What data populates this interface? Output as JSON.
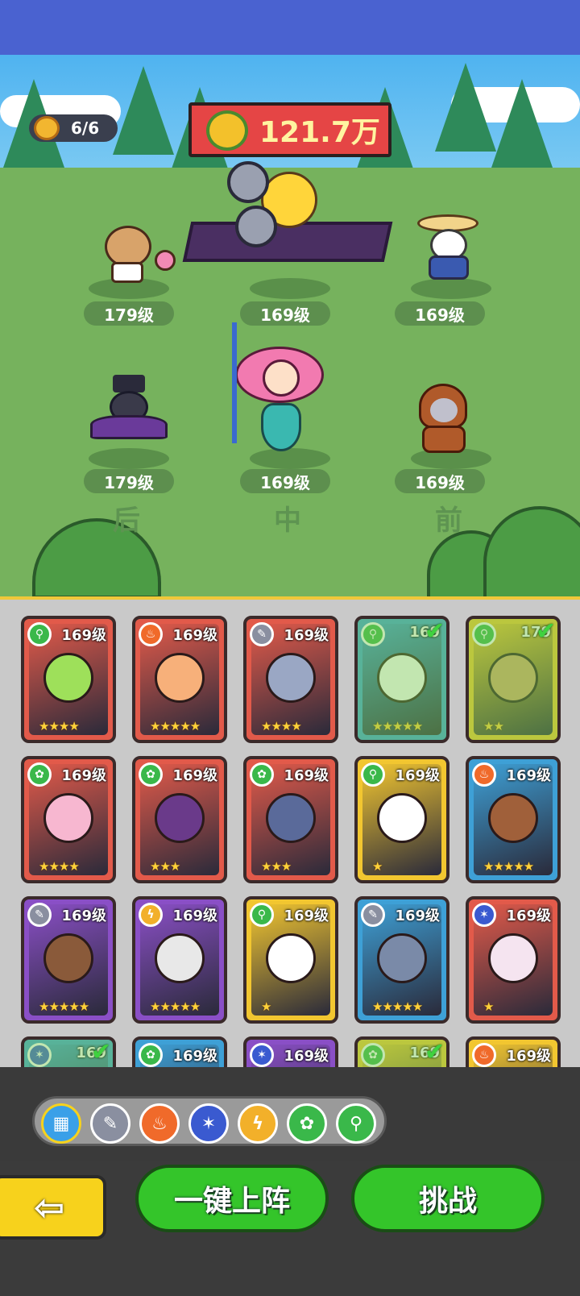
{
  "header": {
    "team_count": "6/6",
    "power": "121.7万"
  },
  "formation": {
    "top": [
      {
        "name": "deer",
        "level": "179级"
      },
      {
        "name": "chicken-warrior",
        "level": "169级"
      },
      {
        "name": "duck-wizard",
        "level": "169级"
      }
    ],
    "bottom": [
      {
        "name": "plague-crow",
        "level": "179级"
      },
      {
        "name": "mermaid",
        "level": "169级"
      },
      {
        "name": "mouse-hood",
        "level": "169级"
      }
    ],
    "row_labels": {
      "back": "后",
      "middle": "中",
      "front": "前"
    }
  },
  "cards": [
    {
      "level": "169级",
      "element": "wind",
      "stars": "★★★★",
      "color": "#e25a4a",
      "face": "#9ee05a",
      "selected": false
    },
    {
      "level": "169级",
      "element": "fire",
      "stars": "★★★★★",
      "color": "#e25a4a",
      "face": "#f7b07a",
      "selected": false
    },
    {
      "level": "169级",
      "element": "steel",
      "stars": "★★★★",
      "color": "#e25a4a",
      "face": "#9aa7c4",
      "selected": false
    },
    {
      "level": "169",
      "element": "wind",
      "stars": "★★★★★",
      "color": "#3ea0d6",
      "face": "#ffffff",
      "selected": true
    },
    {
      "level": "179",
      "element": "wind",
      "stars": "★★",
      "color": "#f2c630",
      "face": "#d6a86a",
      "selected": true
    },
    {
      "level": "169级",
      "element": "poison",
      "stars": "★★★★",
      "color": "#e25a4a",
      "face": "#f7b7d0",
      "selected": false
    },
    {
      "level": "169级",
      "element": "poison",
      "stars": "★★★",
      "color": "#e25a4a",
      "face": "#6a3a8a",
      "selected": false
    },
    {
      "level": "169级",
      "element": "poison",
      "stars": "★★★",
      "color": "#e25a4a",
      "face": "#5a6a9a",
      "selected": false
    },
    {
      "level": "169级",
      "element": "wind",
      "stars": "★",
      "color": "#f2c630",
      "face": "#ffffff",
      "selected": false
    },
    {
      "level": "169级",
      "element": "fire",
      "stars": "★★★★★",
      "color": "#3ea0d6",
      "face": "#a0603a",
      "selected": false
    },
    {
      "level": "169级",
      "element": "steel",
      "stars": "★★★★★",
      "color": "#8a4fc6",
      "face": "#8a5a3a",
      "selected": false
    },
    {
      "level": "169级",
      "element": "thunder",
      "stars": "★★★★★",
      "color": "#8a4fc6",
      "face": "#e8e8e8",
      "selected": false
    },
    {
      "level": "169级",
      "element": "wind",
      "stars": "★",
      "color": "#f2c630",
      "face": "#ffffff",
      "selected": false
    },
    {
      "level": "169级",
      "element": "steel",
      "stars": "★★★★★",
      "color": "#3ea0d6",
      "face": "#7a8aa8",
      "selected": false
    },
    {
      "level": "169级",
      "element": "ice",
      "stars": "★",
      "color": "#e25a4a",
      "face": "#f5e4f0",
      "selected": false
    },
    {
      "level": "169",
      "element": "ice",
      "stars": "",
      "color": "#3ea0d6",
      "face": "#5ad0c0",
      "selected": true
    },
    {
      "level": "169级",
      "element": "poison",
      "stars": "",
      "color": "#3ea0d6",
      "face": "#f5d070",
      "selected": false
    },
    {
      "level": "169级",
      "element": "ice",
      "stars": "",
      "color": "#8a4fc6",
      "face": "#6a8ad0",
      "selected": false
    },
    {
      "level": "169",
      "element": "poison",
      "stars": "",
      "color": "#f2c630",
      "face": "#7ab05a",
      "selected": true
    },
    {
      "level": "169级",
      "element": "fire",
      "stars": "",
      "color": "#f2c630",
      "face": "#8a5a3a",
      "selected": false
    }
  ],
  "element_icons": {
    "wind": "⚲",
    "fire": "♨",
    "steel": "✎",
    "poison": "✿",
    "thunder": "ϟ",
    "ice": "✶"
  },
  "element_colors": {
    "wind": "#3ab84a",
    "fire": "#f06a2a",
    "steel": "#8a8fa0",
    "poison": "#3ab84a",
    "thunder": "#f2b02a",
    "ice": "#3a5ad0",
    "all": "#3aa0e8"
  },
  "filters": [
    {
      "name": "all",
      "glyph": "▦"
    },
    {
      "name": "steel",
      "glyph": "✎"
    },
    {
      "name": "fire",
      "glyph": "♨"
    },
    {
      "name": "ice",
      "glyph": "✶"
    },
    {
      "name": "thunder",
      "glyph": "ϟ"
    },
    {
      "name": "poison",
      "glyph": "✿"
    },
    {
      "name": "wind",
      "glyph": "⚲"
    }
  ],
  "buttons": {
    "back": "⇦",
    "auto_deploy": "一键上阵",
    "challenge": "挑战"
  }
}
